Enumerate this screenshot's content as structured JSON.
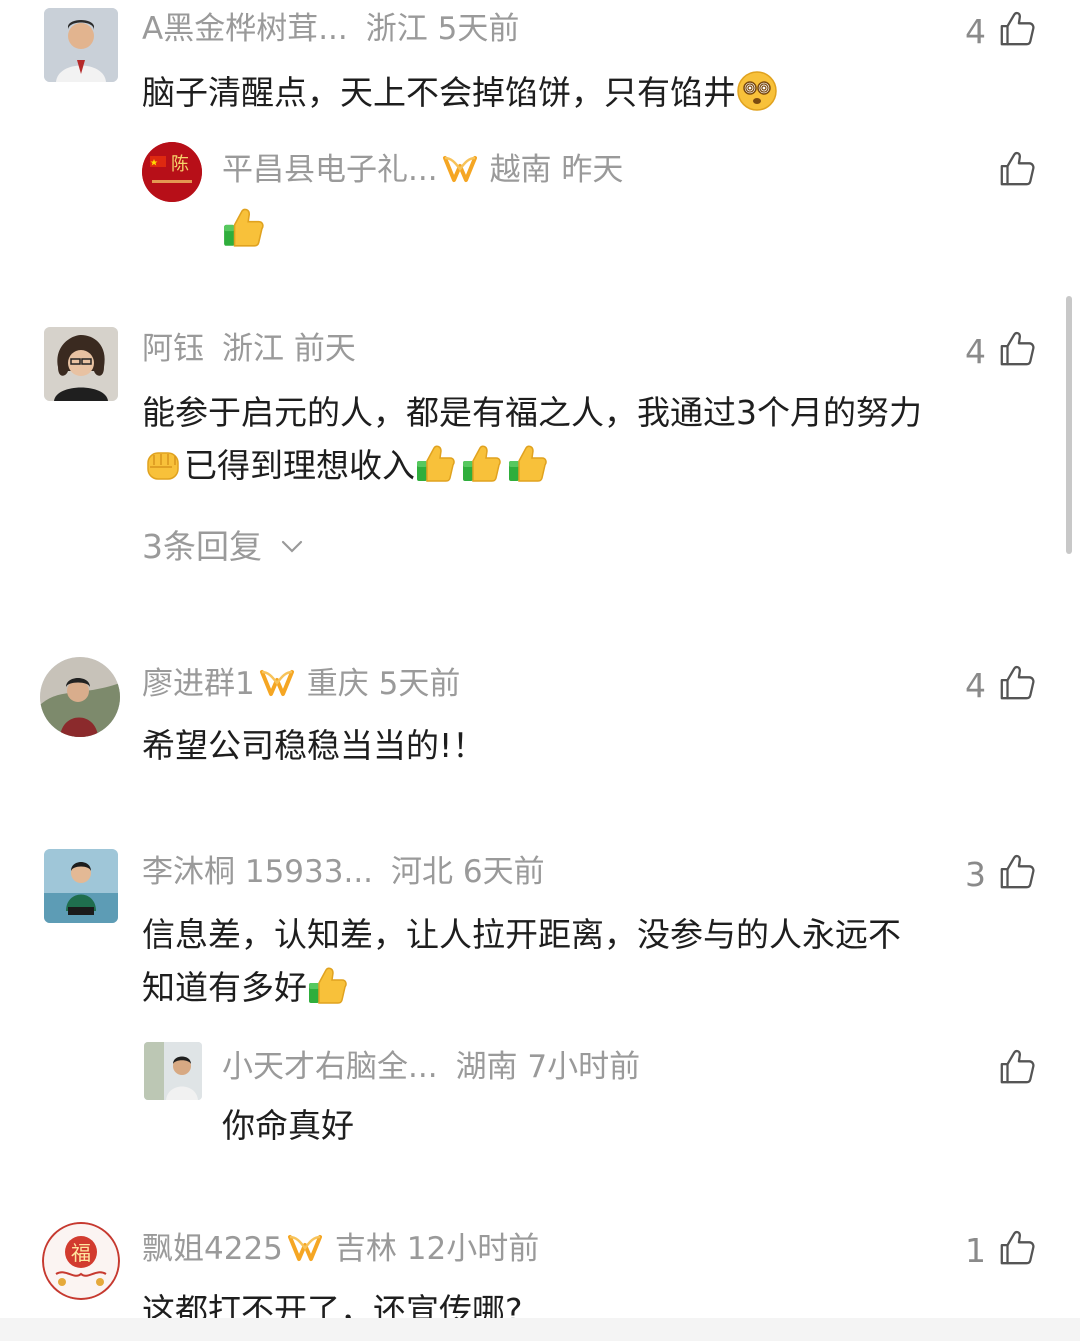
{
  "comments": [
    {
      "user": "A黑金桦树茸...",
      "location": "浙江",
      "time": "5天前",
      "likes": "4",
      "text": "脑子清醒点，天上不会掉馅饼，只有馅井",
      "reply": {
        "user": "平昌县电子礼...",
        "location": "越南",
        "time": "昨天"
      }
    },
    {
      "user": "阿钰",
      "location": "浙江",
      "time": "前天",
      "likes": "4",
      "text_line1": "能参于启元的人，都是有福之人，我通过3个月的努力",
      "text_line2": "已得到理想收入",
      "replies_label": "3条回复"
    },
    {
      "user": "廖进群1",
      "location": "重庆",
      "time": "5天前",
      "likes": "4",
      "text": "希望公司稳稳当当的!！"
    },
    {
      "user": "李沐桐 15933...",
      "location": "河北",
      "time": "6天前",
      "likes": "3",
      "text_line1": "信息差，认知差，让人拉开距离，没参与的人永远不",
      "text_line2": "知道有多好",
      "reply": {
        "user": "小天才右脑全...",
        "location": "湖南",
        "time": "7小时前",
        "text": "你命真好"
      }
    },
    {
      "user": "飘姐4225",
      "location": "吉林",
      "time": "12小时前",
      "likes": "1",
      "text": "这都打不开了，还宣传哪?"
    }
  ],
  "avatar_char": "陈",
  "avatar_fu": "福",
  "colors": {
    "meta": "#9a9a9a",
    "text": "#1e1e1e",
    "vip": "#f5a623",
    "avatar_red": "#c0121b"
  }
}
